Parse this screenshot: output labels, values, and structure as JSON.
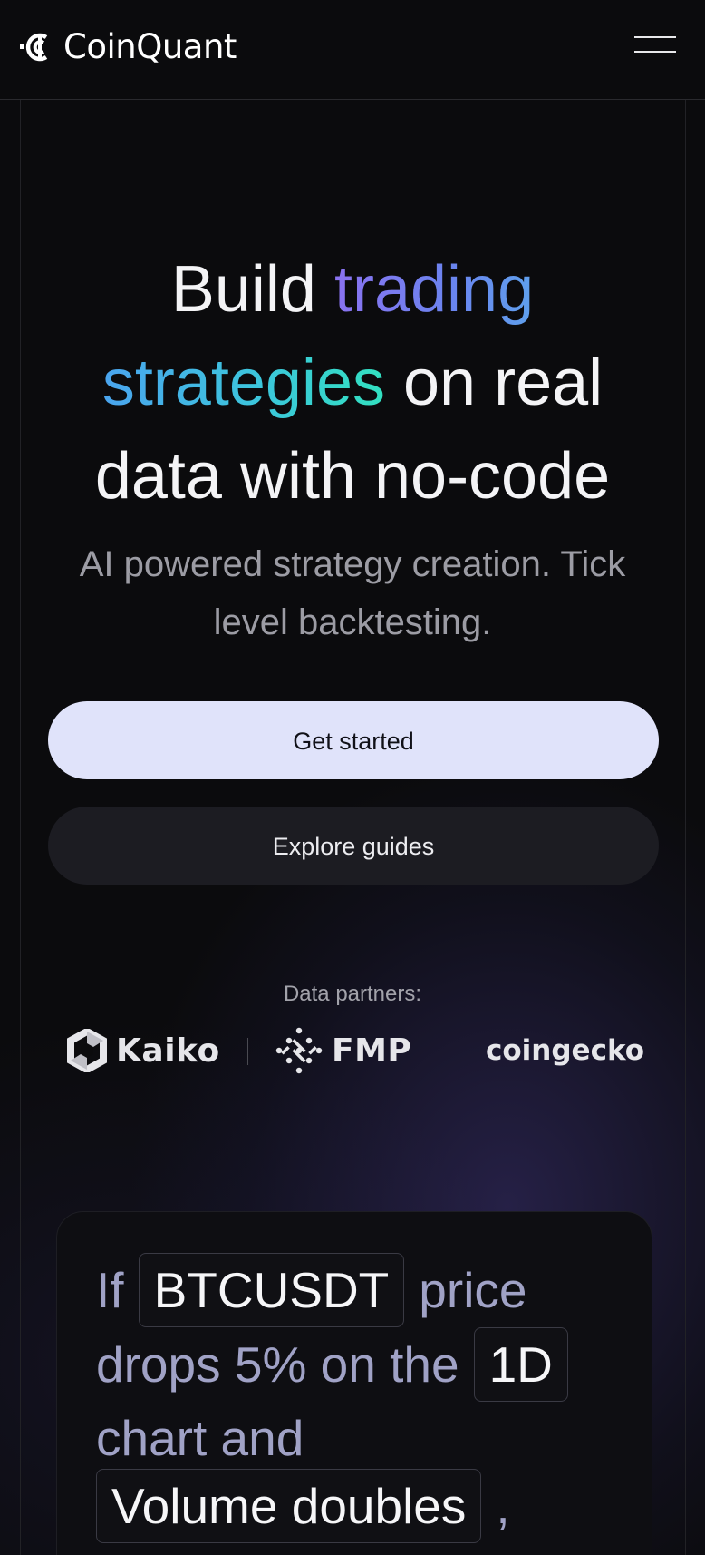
{
  "header": {
    "brand": "CoinQuant",
    "menu_icon": "hamburger-menu-icon"
  },
  "hero": {
    "title_word_1": "Build",
    "title_highlight_1": "trading",
    "title_highlight_2": "strategies",
    "title_rest_line_2": "on real",
    "title_line_3": "data with no-code",
    "subtitle": "AI powered strategy creation. Tick level backtesting."
  },
  "actions": {
    "primary_label": "Get started",
    "secondary_label": "Explore guides"
  },
  "partners": {
    "label": "Data partners:",
    "items": [
      {
        "name": "Kaiko",
        "icon": "kaiko-logo-icon"
      },
      {
        "name": "FMP",
        "icon": "fmp-logo-icon"
      },
      {
        "name": "coingecko",
        "icon": ""
      }
    ]
  },
  "strategy_card": {
    "word_if": "If",
    "chip_symbol": "BTCUSDT",
    "word_price": "price",
    "words_drops": "drops 5% on the",
    "chip_timeframe": "1D",
    "words_chart": "chart and",
    "chip_condition": "Volume doubles",
    "comma": ","
  },
  "colors": {
    "background": "#0b0b0d",
    "primary_button": "#e0e3fa",
    "secondary_button": "#1c1c22",
    "gradient_trading": [
      "#8a72f0",
      "#5fa0ec"
    ],
    "gradient_strategies": [
      "#4aa4ee",
      "#32e0c0"
    ]
  }
}
